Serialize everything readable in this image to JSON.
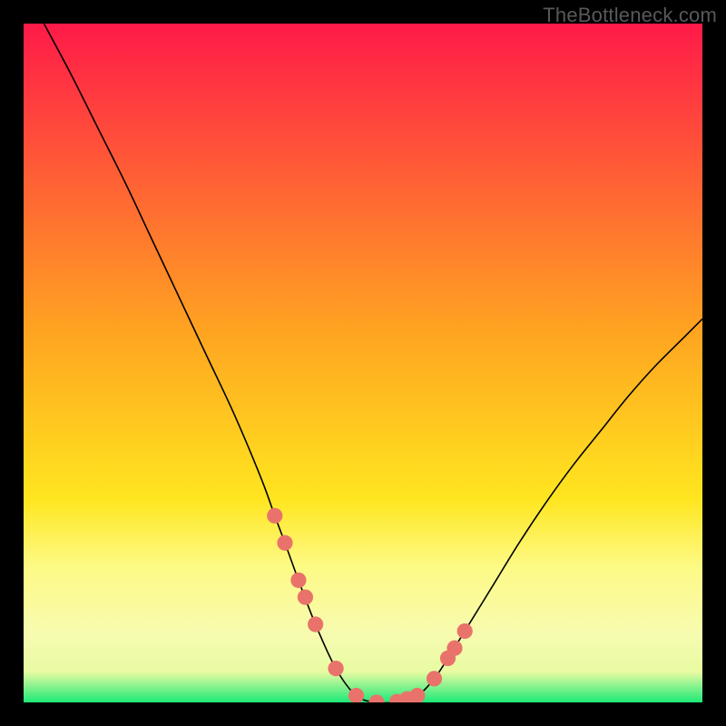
{
  "watermark": "TheBottleneck.com",
  "chart_data": {
    "type": "line",
    "title": "",
    "xlabel": "",
    "ylabel": "",
    "xlim": [
      0,
      100
    ],
    "ylim": [
      0,
      100
    ],
    "grid": false,
    "legend": false,
    "gradient_stops": [
      {
        "offset": 0.0,
        "color": "#ff1a49"
      },
      {
        "offset": 0.45,
        "color": "#ffa321"
      },
      {
        "offset": 0.7,
        "color": "#ffe61f"
      },
      {
        "offset": 0.8,
        "color": "#fdfa85"
      },
      {
        "offset": 0.9,
        "color": "#f7fbb0"
      },
      {
        "offset": 0.955,
        "color": "#e8fba2"
      },
      {
        "offset": 1.0,
        "color": "#1de977"
      }
    ],
    "series": [
      {
        "name": "bottleneck-curve",
        "stroke": "#000000",
        "x": [
          3.0,
          7.0,
          11.0,
          15.0,
          19.0,
          23.0,
          27.0,
          31.0,
          35.0,
          37.0,
          38.5,
          40.5,
          43.0,
          46.0,
          49.0,
          52.0,
          55.0,
          58.0,
          60.5,
          62.5,
          65.0,
          69.0,
          73.0,
          77.0,
          81.0,
          85.0,
          89.0,
          93.0,
          97.0,
          100.0
        ],
        "y": [
          100.0,
          92.5,
          84.5,
          76.5,
          68.0,
          59.5,
          51.0,
          42.5,
          33.0,
          27.5,
          23.5,
          18.0,
          11.5,
          5.0,
          1.0,
          0.0,
          0.1,
          1.0,
          3.5,
          6.5,
          10.5,
          17.0,
          23.5,
          29.5,
          35.0,
          40.0,
          45.0,
          49.5,
          53.5,
          56.5
        ]
      }
    ],
    "markers": {
      "name": "curve-markers",
      "fill": "#e9736b",
      "radius_pct": 1.15,
      "x": [
        37.0,
        38.5,
        40.5,
        41.5,
        43.0,
        46.0,
        49.0,
        52.0,
        55.0,
        56.5,
        58.0,
        60.5,
        62.5,
        63.5,
        65.0
      ],
      "y": [
        27.5,
        23.5,
        18.0,
        15.5,
        11.5,
        5.0,
        1.0,
        0.0,
        0.1,
        0.5,
        1.0,
        3.5,
        6.5,
        8.0,
        10.5
      ]
    }
  }
}
